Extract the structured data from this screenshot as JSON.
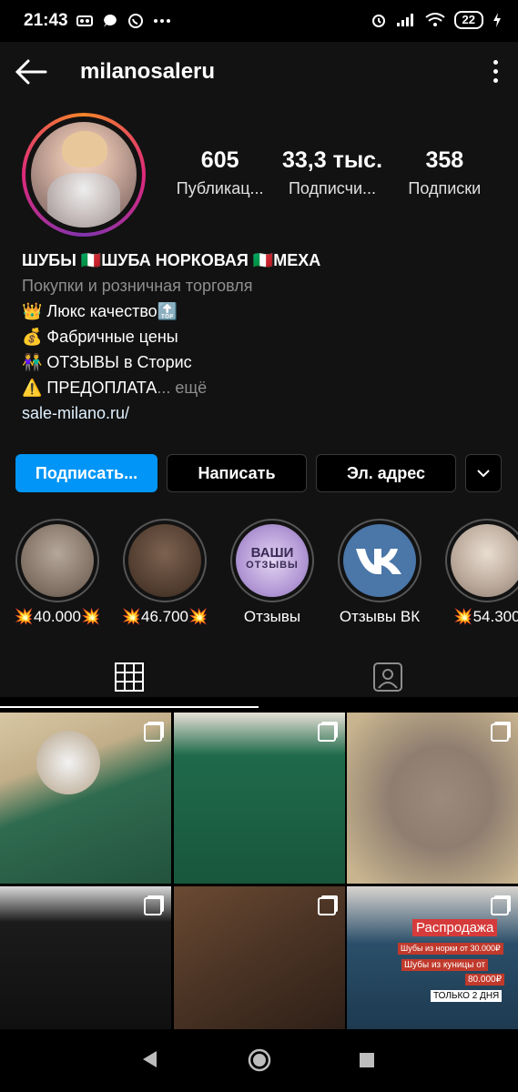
{
  "status": {
    "time": "21:43",
    "battery": "22"
  },
  "header": {
    "username": "milanosaleru"
  },
  "profile": {
    "stats": [
      {
        "value": "605",
        "label": "Публикац..."
      },
      {
        "value": "33,3 тыс.",
        "label": "Подписчи..."
      },
      {
        "value": "358",
        "label": "Подписки"
      }
    ],
    "bio": {
      "name": "ШУБЫ 🇮🇹ШУБА НОРКОВАЯ 🇮🇹МЕХА",
      "category": "Покупки и розничная торговля",
      "lines": [
        "👑 Люкс качество🔝",
        "💰 Фабричные цены",
        "👫 ОТЗЫВЫ в Сторис",
        "⚠️ ПРЕДОПЛАТА"
      ],
      "more": "... ещё",
      "link": "sale-milano.ru/"
    },
    "buttons": {
      "follow": "Подписать...",
      "message": "Написать",
      "email": "Эл. адрес"
    }
  },
  "highlights": [
    {
      "label": "💥40.000💥",
      "color": "#8a7d70"
    },
    {
      "label": "💥46.700💥",
      "color": "#5e4a3c"
    },
    {
      "label": "Отзывы",
      "color": "#b49ad6",
      "inner_title": "ВАШИ",
      "inner_sub": "ОТЗЫВЫ"
    },
    {
      "label": "Отзывы ВК",
      "color": "#4a76a8",
      "inner_title": "VK"
    },
    {
      "label": "💥54.300",
      "color": "#b9a89a"
    }
  ],
  "tabs": [
    "grid-icon",
    "tagged-icon"
  ],
  "grid": [
    {
      "name": "post-1",
      "bg": "#2f6b4f"
    },
    {
      "name": "post-2",
      "bg": "#1f6a4a"
    },
    {
      "name": "post-3",
      "bg": "#8f7e70"
    },
    {
      "name": "post-4",
      "bg": "#1b1b1b"
    },
    {
      "name": "post-5",
      "bg": "#4a3324"
    },
    {
      "name": "post-6",
      "bg": "#2b4f6a",
      "overlay": [
        "Распродажа",
        "Шубы из норки от 30.000₽",
        "Шубы из куницы от",
        "80.000₽",
        "ТОЛЬКО 2 ДНЯ"
      ]
    }
  ]
}
